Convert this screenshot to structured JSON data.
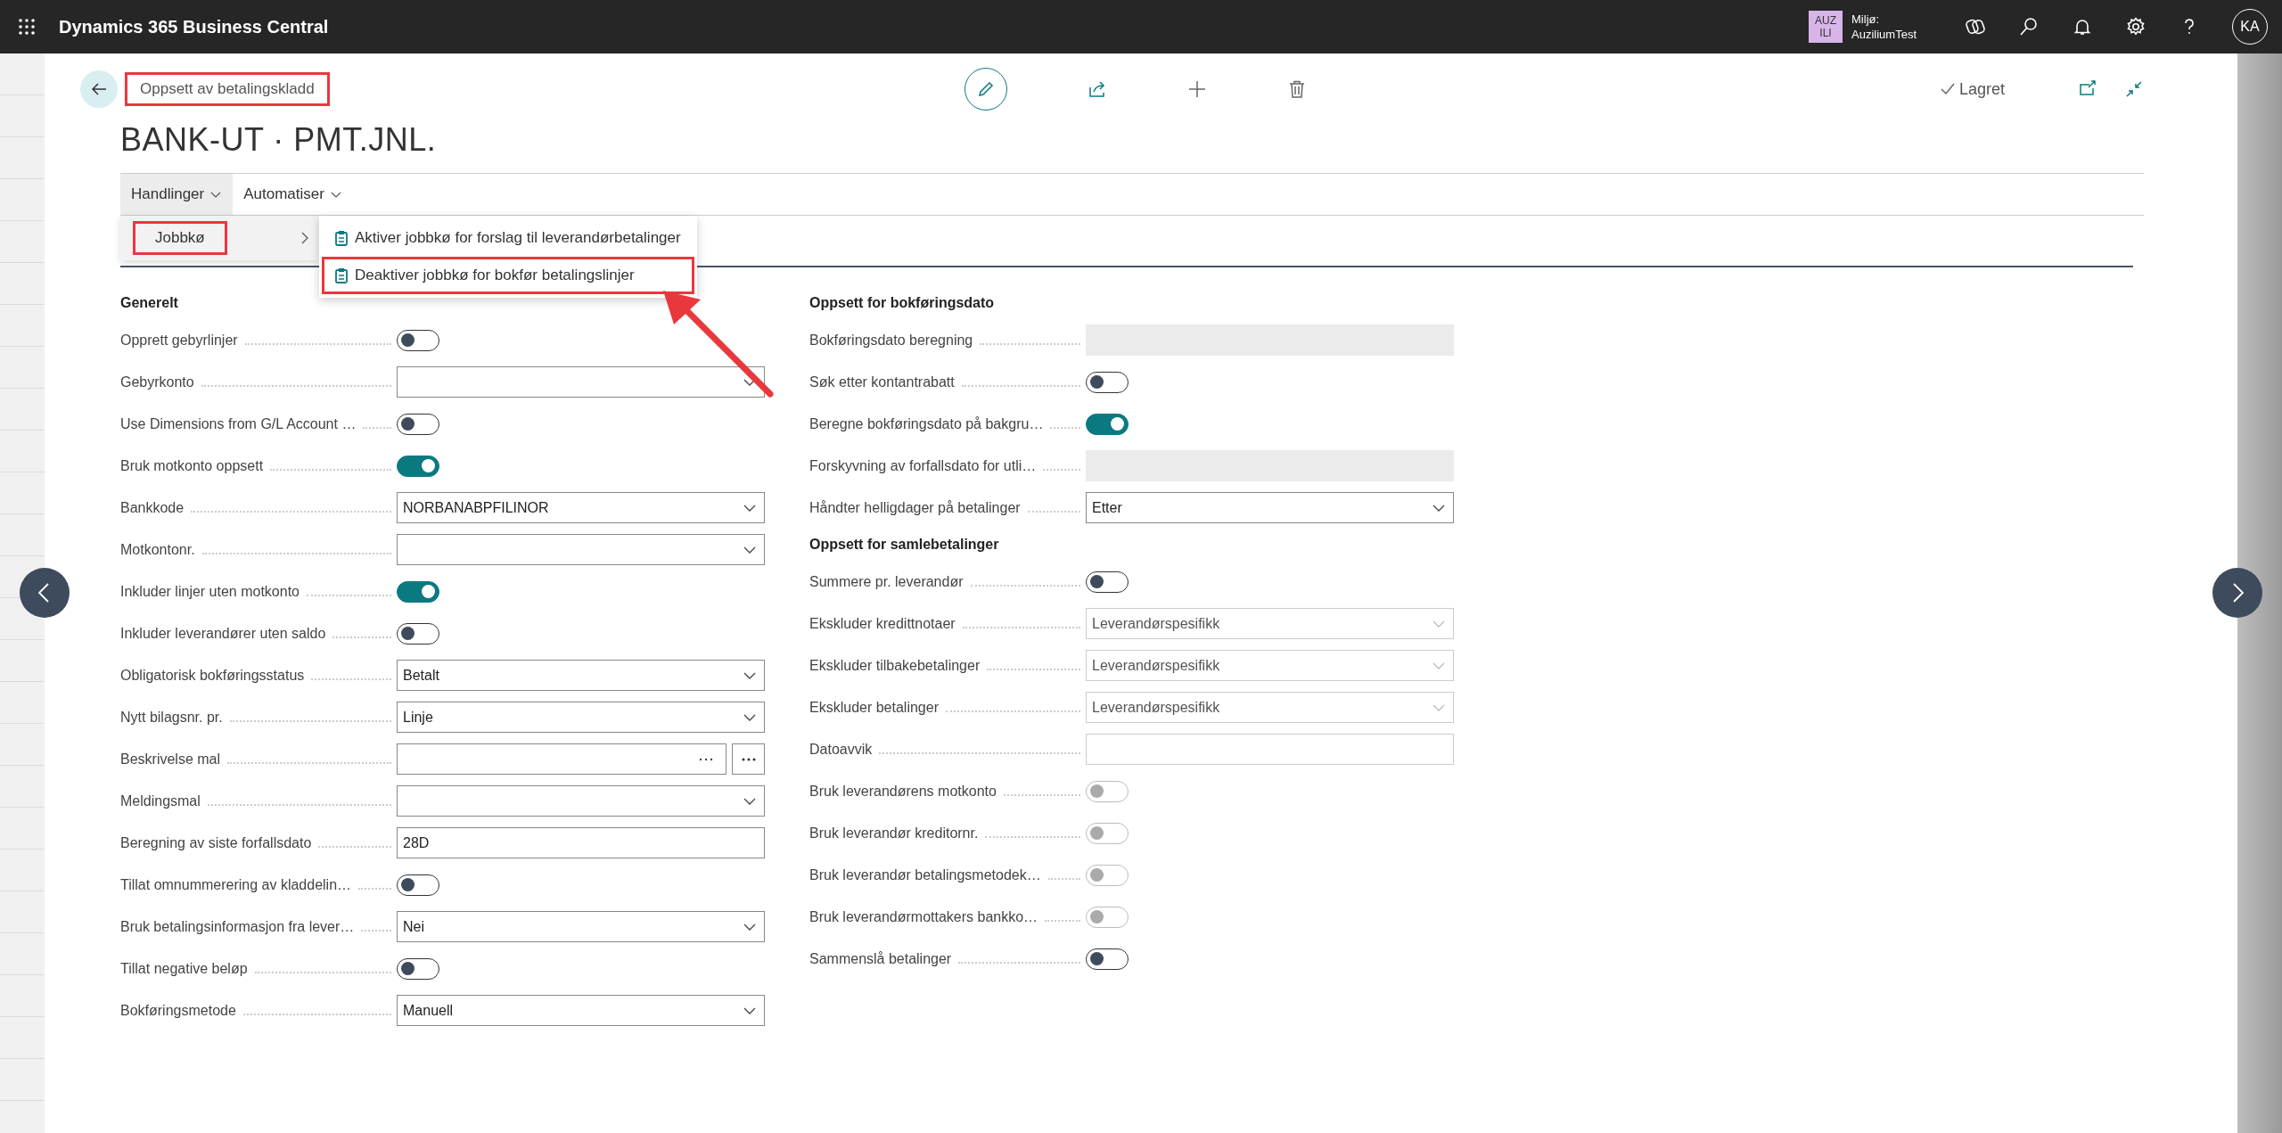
{
  "app_bar": {
    "title": "Dynamics 365 Business Central",
    "environment": {
      "badge": "AUZ ILI",
      "label": "Miljø:",
      "name": "AuziliumTest"
    },
    "user_initials": "KA"
  },
  "page": {
    "breadcrumb": "Oppsett av betalingskladd",
    "breadcrumb_highlighted": true,
    "title": "BANK-UT · PMT.JNL.",
    "saved_status": "Lagret"
  },
  "action_bar": [
    {
      "label": "Handlinger",
      "expanded": true
    },
    {
      "label": "Automatiser",
      "expanded": false
    }
  ],
  "menu": {
    "item": {
      "label": "Jobbkø",
      "highlighted": true
    },
    "submenu": [
      {
        "label": "Aktiver jobbkø for forslag til leverandørbetalinger",
        "highlighted": false
      },
      {
        "label": "Deaktiver jobbkø for bokfør betalingslinjer",
        "highlighted": true
      }
    ]
  },
  "columns": [
    {
      "groups": [
        {
          "title": "Generelt",
          "fields": [
            {
              "kind": "toggle",
              "label": "Opprett gebyrlinjer",
              "on": false,
              "disabled": false
            },
            {
              "kind": "select",
              "label": "Gebyrkonto",
              "disabled": false
            },
            {
              "kind": "toggle",
              "label": "Use Dimensions from G/L Account …",
              "on": false,
              "disabled": false
            },
            {
              "kind": "toggle",
              "label": "Bruk motkonto oppsett",
              "on": true,
              "disabled": false
            },
            {
              "kind": "select",
              "label": "Bankkode",
              "value": "NORBANABPFILINOR",
              "disabled": false
            },
            {
              "kind": "select",
              "label": "Motkontonr.",
              "disabled": false
            },
            {
              "kind": "toggle",
              "label": "Inkluder linjer uten motkonto",
              "on": true,
              "disabled": false
            },
            {
              "kind": "toggle",
              "label": "Inkluder leverandører uten saldo",
              "on": false,
              "disabled": false
            },
            {
              "kind": "select",
              "label": "Obligatorisk bokføringsstatus",
              "value": "Betalt",
              "disabled": false
            },
            {
              "kind": "select",
              "label": "Nytt bilagsnr. pr.",
              "value": "Linje",
              "disabled": false
            },
            {
              "kind": "lookup",
              "label": "Beskrivelse mal",
              "disabled": false
            },
            {
              "kind": "select",
              "label": "Meldingsmal",
              "disabled": false
            },
            {
              "kind": "text",
              "label": "Beregning av siste forfallsdato",
              "value": "28D",
              "disabled": false
            },
            {
              "kind": "toggle",
              "label": "Tillat omnummerering av kladdelin…",
              "on": false,
              "disabled": false
            },
            {
              "kind": "select",
              "label": "Bruk betalingsinformasjon fra lever…",
              "value": "Nei",
              "disabled": false
            },
            {
              "kind": "toggle",
              "label": "Tillat negative beløp",
              "on": false,
              "disabled": false
            },
            {
              "kind": "select",
              "label": "Bokføringsmetode",
              "value": "Manuell",
              "disabled": false
            }
          ]
        }
      ]
    },
    {
      "groups": [
        {
          "title": "Oppsett for bokføringsdato",
          "fields": [
            {
              "kind": "readonly",
              "label": "Bokføringsdato beregning"
            },
            {
              "kind": "toggle",
              "label": "Søk etter kontantrabatt",
              "on": false,
              "disabled": false
            },
            {
              "kind": "toggle",
              "label": "Beregne bokføringsdato på bakgru…",
              "on": true,
              "disabled": false
            },
            {
              "kind": "readonly",
              "label": "Forskyvning av forfallsdato for utli…"
            },
            {
              "kind": "select",
              "label": "Håndter helligdager på betalinger",
              "value": "Etter",
              "disabled": false
            }
          ]
        },
        {
          "title": "Oppsett for samlebetalinger",
          "fields": [
            {
              "kind": "toggle",
              "label": "Summere pr. leverandør",
              "on": false,
              "disabled": false
            },
            {
              "kind": "select",
              "label": "Ekskluder kredittnotaer",
              "value": "Leverandørspesifikk",
              "disabled": true
            },
            {
              "kind": "select",
              "label": "Ekskluder tilbakebetalinger",
              "value": "Leverandørspesifikk",
              "disabled": true
            },
            {
              "kind": "select",
              "label": "Ekskluder betalinger",
              "value": "Leverandørspesifikk",
              "disabled": true
            },
            {
              "kind": "text",
              "label": "Datoavvik",
              "disabled": true
            },
            {
              "kind": "toggle",
              "label": "Bruk leverandørens motkonto",
              "on": false,
              "disabled": true
            },
            {
              "kind": "toggle",
              "label": "Bruk leverandør kreditornr.",
              "on": false,
              "disabled": true
            },
            {
              "kind": "toggle",
              "label": "Bruk leverandør betalingsmetodek…",
              "on": false,
              "disabled": true
            },
            {
              "kind": "toggle",
              "label": "Bruk leverandørmottakers bankko…",
              "on": false,
              "disabled": true
            },
            {
              "kind": "toggle",
              "label": "Sammenslå betalinger",
              "on": false,
              "disabled": false
            }
          ]
        }
      ]
    }
  ]
}
